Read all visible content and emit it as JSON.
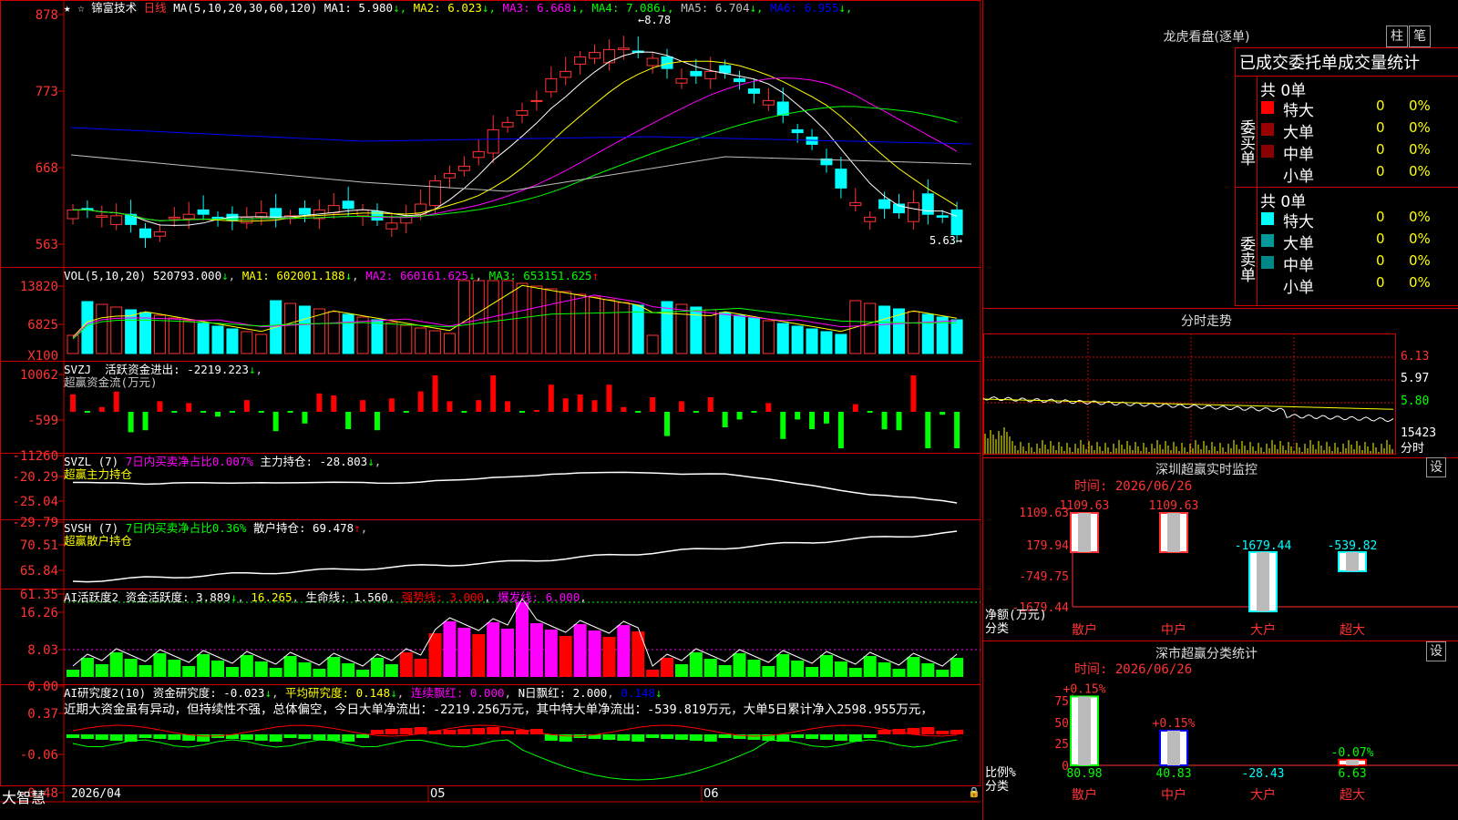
{
  "header": {
    "stock_name": "锦富技术",
    "period": "日线",
    "ma_label": "MA(5,10,20,30,60,120)",
    "ma_values": [
      {
        "name": "MA1",
        "value": "5.980",
        "arrow": "↓",
        "color": "#ffffff"
      },
      {
        "name": "MA2",
        "value": "6.023",
        "arrow": "↓",
        "color": "#ffff00"
      },
      {
        "name": "MA3",
        "value": "6.668",
        "arrow": "↓",
        "color": "#ff00ff"
      },
      {
        "name": "MA4",
        "value": "7.086",
        "arrow": "↓",
        "color": "#00ff00"
      },
      {
        "name": "MA5",
        "value": "6.704",
        "arrow": "↓",
        "color": "#c0c0c0"
      },
      {
        "name": "MA6",
        "value": "6.955",
        "arrow": "↓",
        "color": "#0000ff"
      }
    ],
    "max_label": "8.78",
    "min_label": "5.63"
  },
  "price_axis": [
    "878",
    "773",
    "668",
    "563"
  ],
  "vol_panel": {
    "title": "VOL(5,10,20)",
    "value": "520793.000",
    "ma1": "MA1: 602001.188",
    "ma2": "MA2: 660161.625",
    "ma3": "MA3: 653151.625",
    "axis": [
      "13820",
      "6825",
      "X100"
    ]
  },
  "svzj_panel": {
    "title": "SVZJ",
    "line1": "活跃资金进出: -2219.223",
    "line2": "超赢资金流(万元)",
    "axis": [
      "10062",
      "-599",
      "-11260"
    ]
  },
  "svzl_panel": {
    "title": "SVZL (7)",
    "ratio": "7日内买卖净占比0.007%",
    "hold": "主力持仓: -28.803",
    "line2": "超赢主力持仓",
    "axis": [
      "-20.29",
      "-25.04",
      "-29.79"
    ]
  },
  "svsh_panel": {
    "title": "SVSH (7)",
    "ratio": "7日内买卖净占比0.36%",
    "hold": "散户持仓: 69.478",
    "line2": "超赢散户持仓",
    "axis": [
      "70.51",
      "65.84",
      "61.35"
    ]
  },
  "ai_active_panel": {
    "title": "AI活跃度2",
    "v1": "资金活跃度: 3.889",
    "v2": "16.265",
    "v3": "生命线: 1.560",
    "v4": "强势线: 3.000",
    "v5": "爆发线: 6.000",
    "axis": [
      "16.26",
      "8.03",
      "0.00"
    ]
  },
  "ai_research_panel": {
    "title": "AI研究度2(10)",
    "v1": "资金研究度: -0.023",
    "v2": "平均研究度: 0.148",
    "v3": "连续飘红: 0.000",
    "v4": "N日飘红: 2.000",
    "v5": "0.148",
    "comment": "近期大资金虽有异动，但持续性不强，总体偏空，今日大单净流出：-2219.256万元，其中特大单净流出：-539.819万元，大单5日累计净入2598.955万元，",
    "axis": [
      "0.37",
      "-0.06",
      "-0.48"
    ]
  },
  "bottom_bar": {
    "brand": "大智慧",
    "date": "2026/04",
    "m1": "05",
    "m2": "06"
  },
  "longhu": {
    "title": "龙虎看盘(逐单)",
    "btn1": "柱",
    "btn2": "笔",
    "subtitle": "已成交委托单成交量统计",
    "buy_label": "委买单",
    "sell_label": "委卖单",
    "buy_total": "共 0单",
    "sell_total": "共 0单",
    "buy_rows": [
      {
        "label": "特大",
        "qty": "0",
        "pct": "0%",
        "color": "#ff0000"
      },
      {
        "label": "大单",
        "qty": "0",
        "pct": "0%",
        "color": "#990000"
      },
      {
        "label": "中单",
        "qty": "0",
        "pct": "0%",
        "color": "#880000"
      },
      {
        "label": "小单",
        "qty": "0",
        "pct": "0%",
        "color": "#000000"
      }
    ],
    "sell_rows": [
      {
        "label": "特大",
        "qty": "0",
        "pct": "0%",
        "color": "#00ffff"
      },
      {
        "label": "大单",
        "qty": "0",
        "pct": "0%",
        "color": "#009999"
      },
      {
        "label": "中单",
        "qty": "0",
        "pct": "0%",
        "color": "#008888"
      },
      {
        "label": "小单",
        "qty": "0",
        "pct": "0%",
        "color": "#000000"
      }
    ]
  },
  "intraday": {
    "title": "分时走势",
    "axis": [
      "6.13",
      "5.97",
      "5.80",
      "15423"
    ],
    "label": "分时"
  },
  "sz_monitor": {
    "title": "深圳超赢实时监控",
    "btn": "设",
    "time": "时间: 2026/06/26",
    "axis": [
      "1109.63",
      "179.94",
      "-749.75",
      "-1679.44"
    ],
    "ylabel1": "净额(万元)",
    "ylabel2": "分类",
    "bars": [
      {
        "name": "散户",
        "value": 1109.63,
        "label": "1109.63",
        "color": "#ff3333"
      },
      {
        "name": "中户",
        "value": 1109.63,
        "label": "1109.63",
        "color": "#ff3333"
      },
      {
        "name": "大户",
        "value": -1679.44,
        "label": "-1679.44",
        "color": "#00ffff"
      },
      {
        "name": "超大",
        "value": -539.82,
        "label": "-539.82",
        "color": "#00ffff"
      }
    ]
  },
  "sz_class": {
    "title": "深市超赢分类统计",
    "btn": "设",
    "time": "时间: 2026/06/26",
    "axis": [
      "75",
      "50",
      "25",
      "0"
    ],
    "ylabel1": "比例%",
    "ylabel2": "分类",
    "bars": [
      {
        "name": "散户",
        "value": 80.98,
        "label": "80.98",
        "top": "+0.15%",
        "color": "#00ff00"
      },
      {
        "name": "中户",
        "value": 40.83,
        "label": "40.83",
        "top": "+0.15%",
        "color": "#0000ff"
      },
      {
        "name": "大户",
        "value": -28.43,
        "label": "-28.43",
        "top": "",
        "color": "#00ffff"
      },
      {
        "name": "超大",
        "value": 6.63,
        "label": "6.63",
        "top": "-0.07%",
        "color": "#ff0000"
      }
    ]
  }
}
